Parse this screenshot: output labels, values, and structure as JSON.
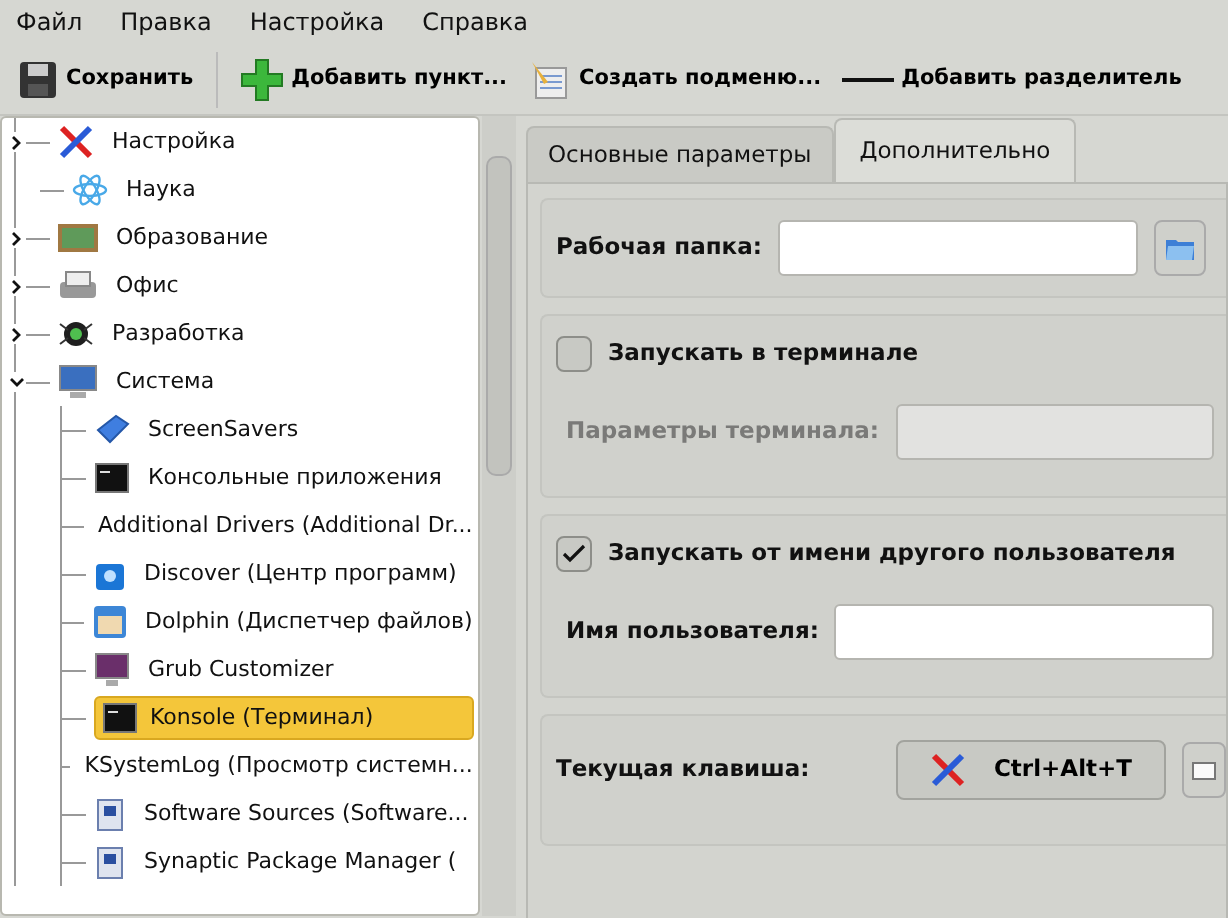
{
  "menu": [
    "Файл",
    "Правка",
    "Настройка",
    "Справка"
  ],
  "toolbar": [
    {
      "label": "Сохранить"
    },
    {
      "label": "Добавить пункт..."
    },
    {
      "label": "Создать подменю..."
    },
    {
      "label": "Добавить разделитель"
    }
  ],
  "tree": [
    {
      "label": "Настройка",
      "expanded": false,
      "selected": false
    },
    {
      "label": "Наука",
      "selected": false
    },
    {
      "label": "Образование",
      "expanded": false,
      "selected": false
    },
    {
      "label": "Офис",
      "expanded": false,
      "selected": false
    },
    {
      "label": "Разработка",
      "expanded": false,
      "selected": false
    },
    {
      "label": "Система",
      "expanded": true,
      "selected": false,
      "children": [
        {
          "label": "ScreenSavers",
          "selected": false
        },
        {
          "label": "Консольные приложения",
          "selected": false
        },
        {
          "label": "Additional Drivers (Additional Dr...",
          "selected": false
        },
        {
          "label": "Discover (Центр программ)",
          "selected": false
        },
        {
          "label": "Dolphin (Диспетчер файлов)",
          "selected": false
        },
        {
          "label": "Grub Customizer",
          "selected": false
        },
        {
          "label": "Konsole (Терминал)",
          "selected": true
        },
        {
          "label": "KSystemLog (Просмотр системн...",
          "selected": false
        },
        {
          "label": "Software Sources (Software...",
          "selected": false
        },
        {
          "label": "Synaptic Package Manager (",
          "selected": false
        }
      ]
    }
  ],
  "tabs": [
    {
      "label": "Основные параметры",
      "selected": false
    },
    {
      "label": "Дополнительно",
      "selected": true
    }
  ],
  "working_folder": {
    "label": "Рабочая папка:"
  },
  "run_in_terminal": {
    "label": "Запускать в терминале",
    "checked": false
  },
  "terminal_options": {
    "label": "Параметры терминала:",
    "disabled": true
  },
  "run_as_other_user": {
    "label": "Запускать от имени другого пользователя",
    "checked": true
  },
  "username": {
    "label": "Имя пользователя:"
  },
  "shortcut": {
    "label": "Текущая клавиша:",
    "key": "Ctrl+Alt+T"
  }
}
